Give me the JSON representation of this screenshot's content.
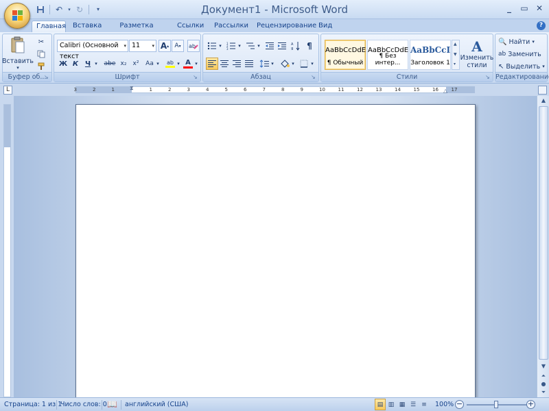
{
  "window": {
    "title": "Документ1 - Microsoft Word",
    "controls": [
      "_",
      "▭",
      "✕"
    ]
  },
  "qat": {
    "save_icon": "save-icon",
    "undo_icon": "undo-icon",
    "redo_icon": "redo-icon"
  },
  "tabs": [
    {
      "label": "Главная",
      "active": true
    },
    {
      "label": "Вставка"
    },
    {
      "label": "Разметка страницы"
    },
    {
      "label": "Ссылки"
    },
    {
      "label": "Рассылки"
    },
    {
      "label": "Рецензирование"
    },
    {
      "label": "Вид"
    }
  ],
  "ribbon": {
    "clipboard": {
      "label": "Буфер об...",
      "paste_label": "Вставить"
    },
    "font": {
      "label": "Шрифт",
      "font_name": "Calibri (Основной текст",
      "font_size": "11",
      "bold": "Ж",
      "italic": "К",
      "underline": "Ч",
      "strike": "abe",
      "subscript": "x₂",
      "superscript": "x²",
      "case": "Aa",
      "grow": "A",
      "shrink": "A",
      "highlight": "ab",
      "font_color": "A"
    },
    "paragraph": {
      "label": "Абзац"
    },
    "styles": {
      "label": "Стили",
      "items": [
        {
          "sample": "AaBbCcDdE",
          "name": "¶ Обычный",
          "selected": true
        },
        {
          "sample": "AaBbCcDdE",
          "name": "¶ Без интер..."
        },
        {
          "sample": "AaBbCcI",
          "name": "Заголовок 1",
          "heading": true
        }
      ],
      "change_label_1": "Изменить",
      "change_label_2": "стили"
    },
    "editing": {
      "label": "Редактирование",
      "find": "Найти",
      "replace": "Заменить",
      "select": "Выделить"
    }
  },
  "ruler": {
    "ticks": [
      "3",
      "2",
      "1",
      "1",
      "2",
      "3",
      "4",
      "5",
      "6",
      "7",
      "8",
      "9",
      "10",
      "11",
      "12",
      "13",
      "14",
      "15",
      "16",
      "17"
    ]
  },
  "status": {
    "page": "Страница: 1 из 1",
    "words": "Число слов: 0",
    "language": "английский (США)",
    "zoom": "100%"
  },
  "colors": {
    "accent": "#15428b",
    "highlight": "#ffff00",
    "font_color": "#ff0000"
  }
}
